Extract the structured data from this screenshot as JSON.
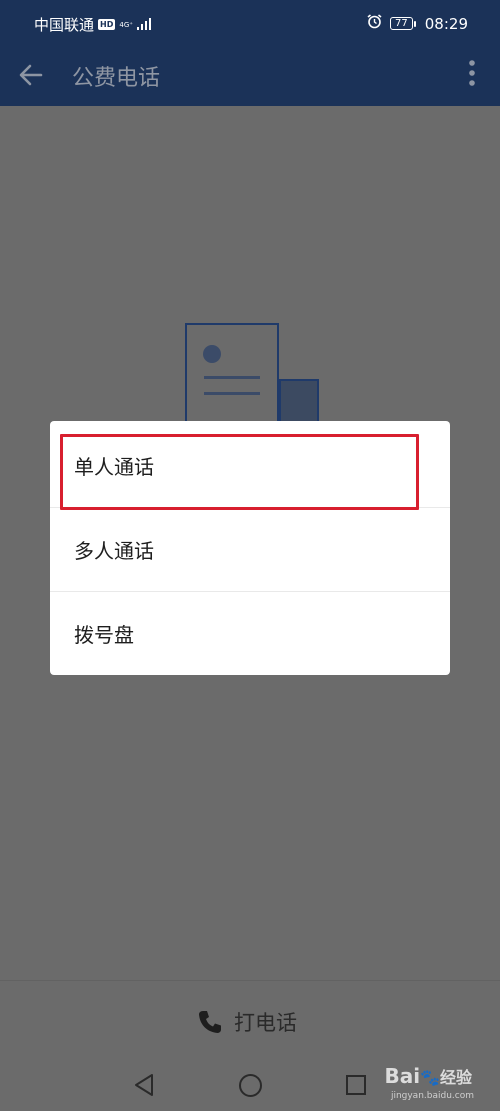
{
  "status_bar": {
    "carrier": "中国联通",
    "hd_badge": "HD",
    "network": "4G⁺",
    "battery": "77",
    "time": "08:29"
  },
  "app_bar": {
    "title": "公费电话",
    "back_icon": "arrow-left-icon",
    "more_icon": "more-vertical-icon"
  },
  "dialog": {
    "options": [
      "单人通话",
      "多人通话",
      "拨号盘"
    ],
    "highlight_color": "#d81f2f"
  },
  "call_bar": {
    "label": "打电话",
    "icon": "phone-icon"
  },
  "watermark": {
    "brand": "Bai",
    "brand_suffix": "经验",
    "url": "jingyan.baidu.com"
  },
  "colors": {
    "header": "#1b3258",
    "overlay": "#6b6b6b",
    "dialog": "#ffffff"
  }
}
